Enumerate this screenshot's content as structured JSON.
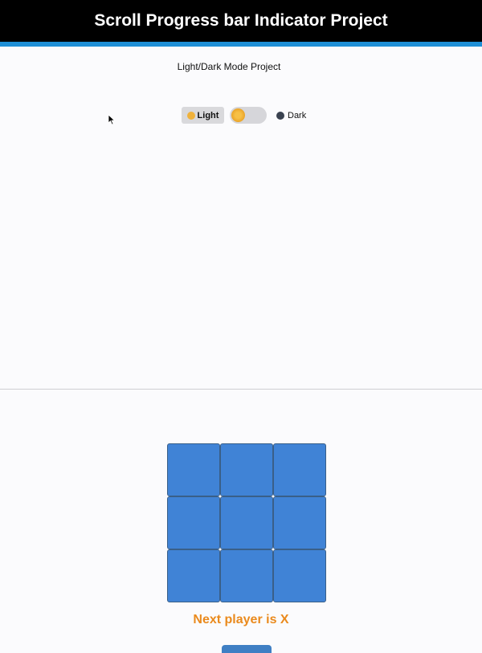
{
  "header": {
    "title": "Scroll Progress bar Indicator Project",
    "scroll_progress": 1.0,
    "progress_color": "#1e8fd6"
  },
  "theme_toggle": {
    "title": "Light/Dark Mode Project",
    "light_label": "Light",
    "light_icon": "sun-face-emoji",
    "dark_label": "Dark",
    "dark_icon": "new-moon-emoji",
    "selected": "Light"
  },
  "game": {
    "cells": [
      "",
      "",
      "",
      "",
      "",
      "",
      "",
      "",
      ""
    ],
    "cell_color": "#4083d6",
    "status": "Next player is X",
    "status_color": "#ea8a1d"
  }
}
